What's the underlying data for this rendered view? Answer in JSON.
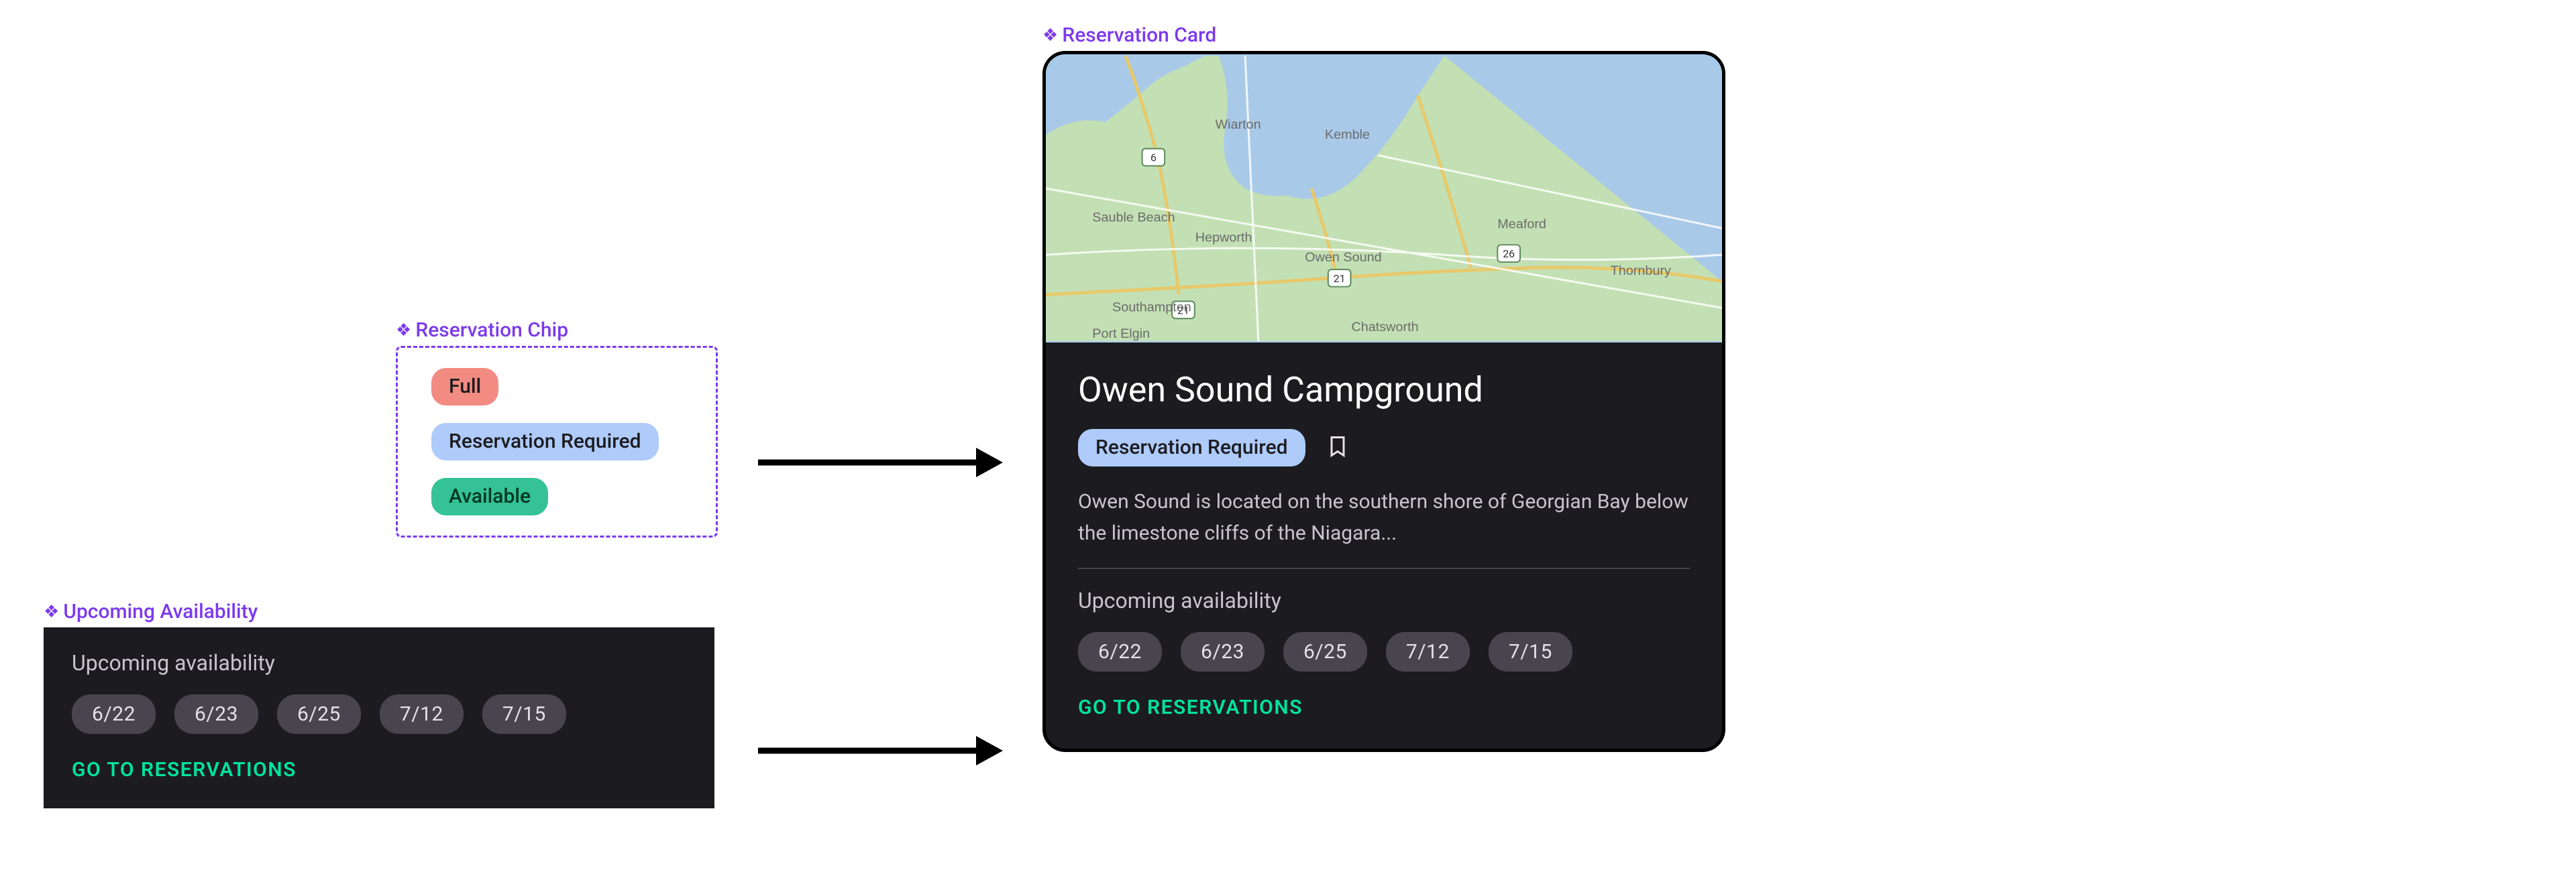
{
  "component_labels": {
    "chip": "Reservation Chip",
    "availability": "Upcoming Availability",
    "card": "Reservation Card"
  },
  "chips": {
    "full": "Full",
    "required": "Reservation Required",
    "available": "Available"
  },
  "availability": {
    "title": "Upcoming availability",
    "dates": [
      "6/22",
      "6/23",
      "6/25",
      "7/12",
      "7/15"
    ],
    "cta": "GO TO RESERVATIONS"
  },
  "card": {
    "title": "Owen Sound Campground",
    "chip_label": "Reservation Required",
    "description": "Owen Sound is located on the southern shore of Georgian Bay below the limestone cliffs of the Niagara...",
    "availability_title": "Upcoming availability",
    "dates": [
      "6/22",
      "6/23",
      "6/25",
      "7/12",
      "7/15"
    ],
    "cta": "GO TO RESERVATIONS"
  },
  "map_labels": [
    "Wiarton",
    "Kemble",
    "Sauble Beach",
    "Hepworth",
    "Owen Sound",
    "Meaford",
    "Thornbury",
    "Southampton",
    "Port Elgin",
    "Chatsworth"
  ],
  "colors": {
    "purple": "#7c3aed",
    "dark_surface": "#1c1b1f",
    "chip_full": "#f28b82",
    "chip_required": "#aecbfa",
    "chip_available": "#34c296",
    "cta_green": "#00e29e"
  }
}
